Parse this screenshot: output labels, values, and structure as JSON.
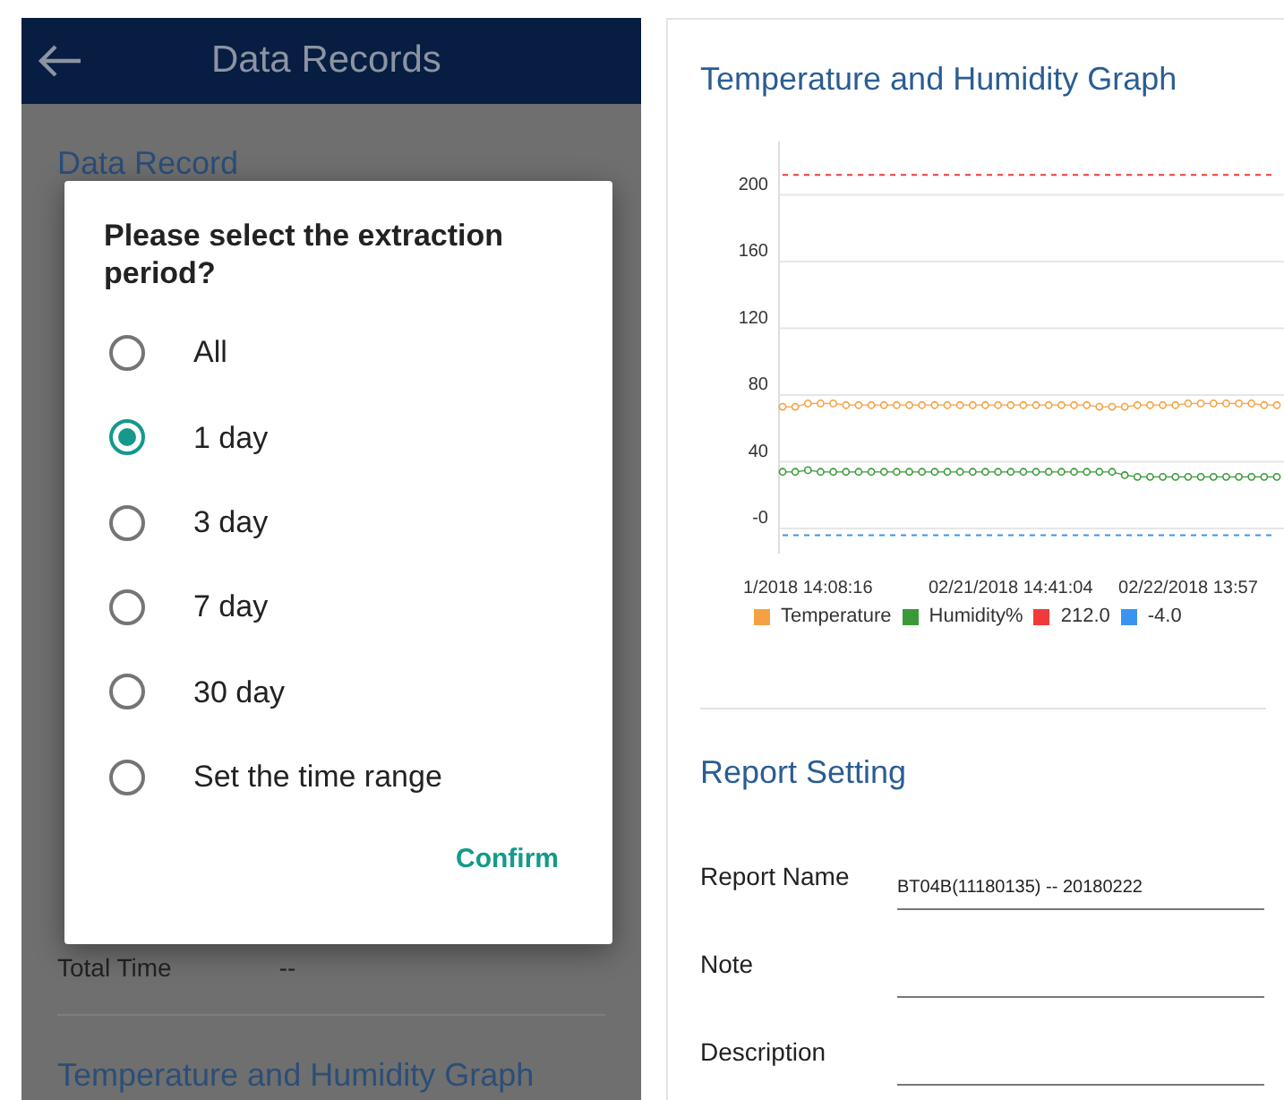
{
  "app_bar": {
    "title": "Data Records"
  },
  "background": {
    "heading": "Data Record",
    "rows": [
      {
        "label": "Total Time",
        "value": "--"
      }
    ],
    "footer_heading": "Temperature and Humidity Graph"
  },
  "dialog": {
    "title": "Please select the extraction period?",
    "options": [
      {
        "label": "All",
        "selected": false
      },
      {
        "label": "1 day",
        "selected": true
      },
      {
        "label": "3 day",
        "selected": false
      },
      {
        "label": "7 day",
        "selected": false
      },
      {
        "label": "30 day",
        "selected": false
      },
      {
        "label": "Set the time range",
        "selected": false
      }
    ],
    "confirm": "Confirm"
  },
  "graph": {
    "title": "Temperature and Humidity Graph",
    "chart_data": {
      "type": "line",
      "ylim": [
        -15,
        232
      ],
      "yticks": [
        {
          "value": 0,
          "label": "-0"
        },
        40,
        80,
        120,
        160,
        200
      ],
      "categories": [
        null,
        null,
        "1/2018 14:08:16",
        null,
        null,
        null,
        null,
        null,
        null,
        null,
        null,
        null,
        null,
        null,
        null,
        null,
        null,
        null,
        "02/21/2018 14:41:04",
        null,
        null,
        null,
        null,
        null,
        null,
        null,
        null,
        null,
        null,
        null,
        null,
        null,
        "02/22/2018 13:57",
        null,
        null,
        null,
        null,
        null,
        null,
        null
      ],
      "grid": true,
      "series": [
        {
          "name": "Temperature",
          "color": "#f5a142",
          "marker": "o",
          "values": [
            73,
            73,
            75,
            75,
            75,
            74,
            74,
            74,
            74,
            74,
            74,
            74,
            74,
            74,
            74,
            74,
            74,
            74,
            74,
            74,
            74,
            74,
            74,
            74,
            74,
            73,
            73,
            73,
            74,
            74,
            74,
            74,
            75,
            75,
            75,
            75,
            75,
            75,
            74,
            74
          ]
        },
        {
          "name": "Humidity%",
          "color": "#3a9a3a",
          "marker": "o",
          "values": [
            34,
            34,
            35,
            34,
            34,
            34,
            34,
            34,
            34,
            34,
            34,
            34,
            34,
            34,
            34,
            34,
            34,
            34,
            34,
            34,
            34,
            34,
            34,
            34,
            34,
            34,
            34,
            32,
            31,
            31,
            31,
            31,
            31,
            31,
            31,
            31,
            31,
            31,
            31,
            31
          ]
        },
        {
          "name": "212.0",
          "color": "#f03a3a",
          "line_style": "dashed",
          "values": [
            212,
            212,
            212,
            212,
            212,
            212,
            212,
            212,
            212,
            212,
            212,
            212,
            212,
            212,
            212,
            212,
            212,
            212,
            212,
            212,
            212,
            212,
            212,
            212,
            212,
            212,
            212,
            212,
            212,
            212,
            212,
            212,
            212,
            212,
            212,
            212,
            212,
            212,
            212,
            212
          ]
        },
        {
          "name": "-4.0",
          "color": "#3a93f0",
          "line_style": "dashed",
          "values": [
            -4,
            -4,
            -4,
            -4,
            -4,
            -4,
            -4,
            -4,
            -4,
            -4,
            -4,
            -4,
            -4,
            -4,
            -4,
            -4,
            -4,
            -4,
            -4,
            -4,
            -4,
            -4,
            -4,
            -4,
            -4,
            -4,
            -4,
            -4,
            -4,
            -4,
            -4,
            -4,
            -4,
            -4,
            -4,
            -4,
            -4,
            -4,
            -4,
            -4
          ]
        }
      ]
    }
  },
  "report_setting": {
    "title": "Report Setting",
    "fields": [
      {
        "label": "Report Name",
        "value": "BT04B(11180135) -- 20180222"
      },
      {
        "label": "Note"
      },
      {
        "label": "Description"
      }
    ]
  }
}
